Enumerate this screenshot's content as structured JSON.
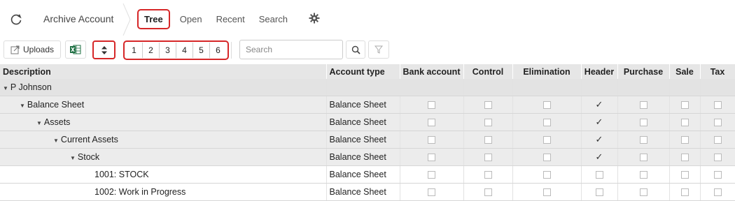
{
  "header": {
    "app_title": "Archive Account",
    "tabs": [
      {
        "label": "Tree",
        "active": true
      },
      {
        "label": "Open",
        "active": false
      },
      {
        "label": "Recent",
        "active": false
      },
      {
        "label": "Search",
        "active": false
      }
    ]
  },
  "toolbar": {
    "uploads_label": "Uploads",
    "levels": [
      "1",
      "2",
      "3",
      "4",
      "5",
      "6"
    ],
    "search_placeholder": "Search",
    "search_value": ""
  },
  "table": {
    "columns": [
      "Description",
      "Account type",
      "Bank account",
      "Control",
      "Elimination",
      "Header",
      "Purchase",
      "Sale",
      "Tax"
    ],
    "rows": [
      {
        "description": "P Johnson",
        "account_type": "",
        "caret": true,
        "level": 0,
        "flags": null
      },
      {
        "description": "Balance Sheet",
        "account_type": "Balance Sheet",
        "caret": true,
        "level": 1,
        "flags": [
          false,
          false,
          false,
          true,
          false,
          false,
          false
        ]
      },
      {
        "description": "Assets",
        "account_type": "Balance Sheet",
        "caret": true,
        "level": 2,
        "flags": [
          false,
          false,
          false,
          true,
          false,
          false,
          false
        ]
      },
      {
        "description": "Current Assets",
        "account_type": "Balance Sheet",
        "caret": true,
        "level": 3,
        "flags": [
          false,
          false,
          false,
          true,
          false,
          false,
          false
        ]
      },
      {
        "description": "Stock",
        "account_type": "Balance Sheet",
        "caret": true,
        "level": 4,
        "flags": [
          false,
          false,
          false,
          true,
          false,
          false,
          false
        ]
      },
      {
        "description": "1001: STOCK",
        "account_type": "Balance Sheet",
        "caret": false,
        "level": 5,
        "flags": [
          false,
          false,
          false,
          false,
          false,
          false,
          false
        ]
      },
      {
        "description": "1002: Work in Progress",
        "account_type": "Balance Sheet",
        "caret": false,
        "level": 5,
        "flags": [
          false,
          false,
          false,
          false,
          false,
          false,
          false
        ]
      }
    ]
  },
  "colors": {
    "highlight": "#d62728",
    "excel_green": "#1d6f42",
    "header_bg": "#e6e6e6"
  },
  "icons": {
    "refresh": "refresh-icon",
    "gear": "gear-icon",
    "uploads": "external-link-icon",
    "excel": "excel-icon",
    "sort": "sort-icon",
    "search": "search-icon",
    "filter": "filter-icon"
  }
}
